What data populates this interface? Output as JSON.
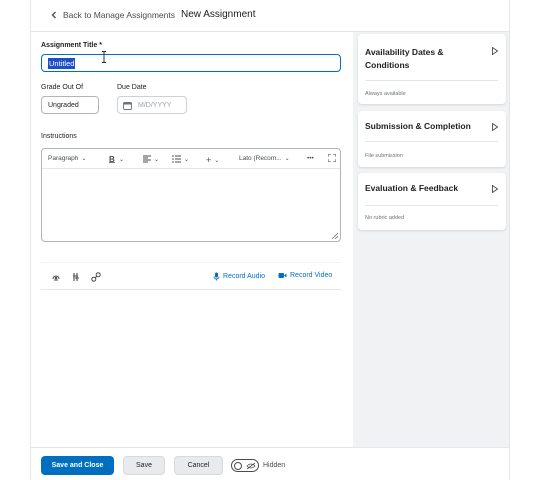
{
  "header": {
    "back_label": "Back to Manage Assignments",
    "page_title": "New Assignment"
  },
  "form": {
    "title_label": "Assignment Title *",
    "title_value": "Untitled",
    "grade_label": "Grade Out Of",
    "grade_value": "Ungraded",
    "due_label": "Due Date",
    "due_placeholder": "M/D/YYYY",
    "instructions_label": "Instructions"
  },
  "editor_toolbar": {
    "format": "Paragraph",
    "font": "Lato (Recom...",
    "more": "•••"
  },
  "attachments": {
    "record_audio": "Record Audio",
    "record_video": "Record Video"
  },
  "side_panel": {
    "cards": [
      {
        "title_line1": "Availability Dates &",
        "title_line2": "Conditions",
        "subtitle": "Always available"
      },
      {
        "title_line1": "Submission & Completion",
        "title_line2": "",
        "subtitle": "File submission"
      },
      {
        "title_line1": "Evaluation & Feedback",
        "title_line2": "",
        "subtitle": "No rubric added"
      }
    ]
  },
  "footer": {
    "save_close": "Save and Close",
    "save": "Save",
    "cancel": "Cancel",
    "visibility": "Hidden"
  },
  "colors": {
    "accent": "#006fbf",
    "selection": "#1e4fc6",
    "side_bg": "#f1f2f4"
  }
}
